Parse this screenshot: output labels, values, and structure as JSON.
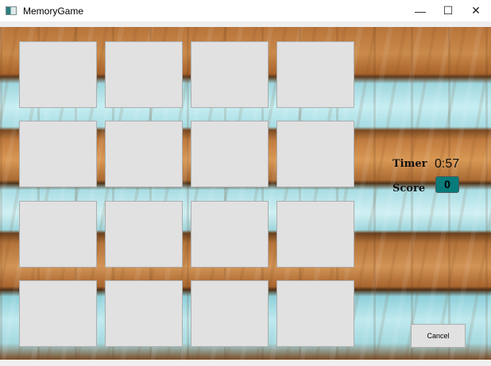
{
  "window": {
    "title": "MemoryGame",
    "icon": "app-icon",
    "controls": [
      "minimize",
      "maximize",
      "close"
    ]
  },
  "game": {
    "card_count": 16,
    "cards_face_down": true,
    "timer_label": "Timer",
    "timer_value": "0:57",
    "score_label": "Score",
    "score_value": "0",
    "cancel_label": "Cancel",
    "score_color": "#087b7b"
  }
}
